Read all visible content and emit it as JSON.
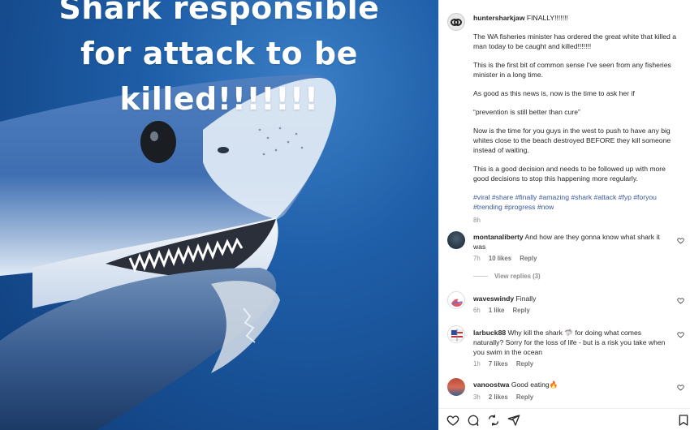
{
  "overlay": {
    "line1": "Shark responsible",
    "line2": "for attack to be",
    "line3": "killed!!!!!!!"
  },
  "post": {
    "username": "huntersharkjaw",
    "first_line": "FINALLY!!!!!!!",
    "paragraphs": [
      "The WA fisheries minister has ordered the great white that killed a man today to be caught and killed!!!!!!!",
      "This is the first bit of common sense I've seen from any fisheries minister in a long time.",
      "As good as this news is, now is the time to ask her if",
      "“prevention is still better than cure”",
      "Now is the time for you guys in the west to push to have any big whites close to the beach destroyed BEFORE they kill someone instead of waiting.",
      "This is a good decision and needs to be followed up with more good decisions to stop this happening more regularly."
    ],
    "hashtags": "#viral #share #finally #amazing #shark #attack #fyp #foryou #trending #progress #now",
    "time": "8h"
  },
  "comments": [
    {
      "username": "montanaliberty",
      "text": "And how are they gonna know what shark it was",
      "time": "7h",
      "likes": "10 likes",
      "reply": "Reply",
      "view_replies": "View replies (3)"
    },
    {
      "username": "waveswindy",
      "text": "Finally",
      "time": "6h",
      "likes": "1 like",
      "reply": "Reply"
    },
    {
      "username": "larbuck88",
      "text": "Why kill the shark 🦈 for doing what comes naturally? Sorry for the loss of life - but is a risk you take when you swim in the ocean",
      "time": "1h",
      "likes": "7 likes",
      "reply": "Reply"
    },
    {
      "username": "vanoostwa",
      "text": "Good eating🔥",
      "time": "3h",
      "likes": "2 likes",
      "reply": "Reply"
    }
  ],
  "icons": {
    "like": "heart-icon",
    "comment": "comment-icon",
    "share": "share-icon",
    "send": "send-icon",
    "save": "bookmark-icon"
  }
}
